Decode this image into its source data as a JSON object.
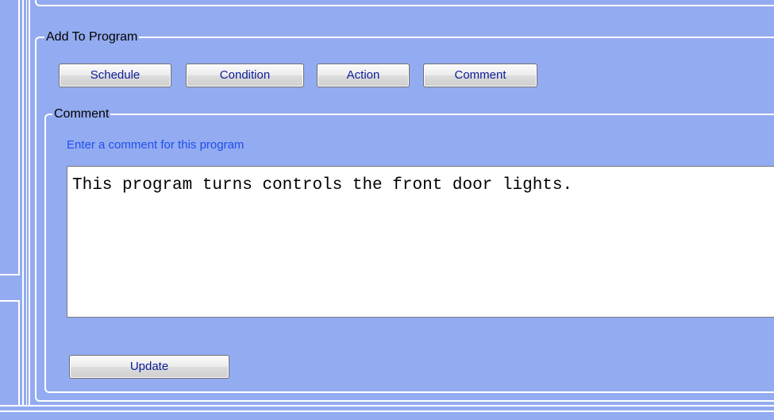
{
  "add_to_program": {
    "legend": "Add To Program",
    "buttons": {
      "schedule": "Schedule",
      "condition": "Condition",
      "action": "Action",
      "comment": "Comment"
    }
  },
  "comment_group": {
    "legend": "Comment",
    "hint": "Enter a comment for this program",
    "value": "This program turns controls the front door lights.",
    "update_label": "Update"
  },
  "colors": {
    "panel_background": "#93abf0",
    "hint_text": "#1f4ff0",
    "button_text": "#0c1c9a"
  }
}
